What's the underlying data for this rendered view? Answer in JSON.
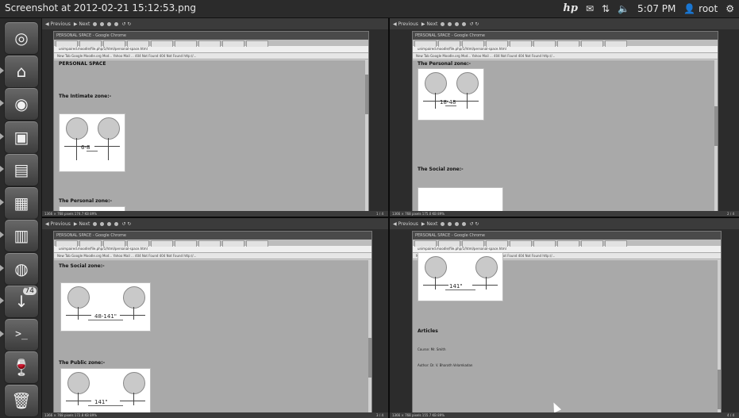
{
  "window_title": "Screenshot at 2012-02-21 15:12:53.png",
  "tray": {
    "brand": "hp",
    "mail_icon": "envelope-icon",
    "network_icon": "arrows-updown-icon",
    "volume_icon": "speaker-icon",
    "time": "5:07 PM",
    "user": "root",
    "gear_icon": "gear-icon"
  },
  "launcher": {
    "items": [
      {
        "name": "ubuntu-dash-icon",
        "glyph": "◎"
      },
      {
        "name": "home-folder-icon",
        "glyph": "⌂"
      },
      {
        "name": "chrome-icon",
        "glyph": "◉"
      },
      {
        "name": "image-viewer-icon",
        "glyph": "▣"
      },
      {
        "name": "writer-icon",
        "glyph": "▤"
      },
      {
        "name": "calc-icon",
        "glyph": "▦"
      },
      {
        "name": "impress-icon",
        "glyph": "▥"
      },
      {
        "name": "firefox-icon",
        "glyph": "◍"
      },
      {
        "name": "update-manager-icon",
        "glyph": "↓",
        "badge": "74"
      },
      {
        "name": "terminal-icon",
        "glyph": ">_"
      },
      {
        "name": "wine-icon",
        "glyph": "🍷"
      },
      {
        "name": "trash-icon",
        "glyph": "🗑"
      }
    ]
  },
  "viewer": {
    "toolbar_prev": "Previous",
    "toolbar_next": "Next"
  },
  "panes": [
    {
      "browser_title": "PERSONAL SPACE - Google Chrome",
      "url": "unimpaired.moodle/file.php/1/html/personal-space.html",
      "bookmarks": "New Tab   Google   Moodle.org Mod...   Yahoo Mail ...   404 Not Found   404 Not Found   http://...",
      "headings": [
        "PERSONAL SPACE",
        "The Intimate zone:-",
        "The Personal zone:-"
      ],
      "measure": "6-8",
      "status": "1366 × 768 pixels  174.7 KB  89%",
      "page_num": "1 / 4"
    },
    {
      "browser_title": "PERSONAL SPACE - Google Chrome",
      "url": "unimpaired.moodle/file.php/1/html/personal-space.html",
      "bookmarks": "New Tab   Google   Moodle.org Mod...   Yahoo Mail ...   404 Not Found   404 Not Found   http://...",
      "headings": [
        "The Personal zone:-",
        "The Social zone:-"
      ],
      "measure": "18-48",
      "status": "1366 × 768 pixels  175.0 KB  89%",
      "page_num": "2 / 4"
    },
    {
      "browser_title": "PERSONAL SPACE - Google Chrome",
      "url": "unimpaired.moodle/file.php/1/html/personal-space.html",
      "bookmarks": "New Tab   Google   Moodle.org Mod...   Yahoo Mail ...   404 Not Found   404 Not Found   http://...",
      "headings": [
        "The Social zone:-",
        "The Public zone:-"
      ],
      "measure": "48-141\"",
      "measure2": "141\"",
      "status": "1366 × 768 pixels  172.8 KB  89%",
      "page_num": "3 / 4"
    },
    {
      "browser_title": "PERSONAL SPACE - Google Chrome",
      "url": "unimpaired.moodle/file.php/1/html/personal-space.html",
      "bookmarks": "New Tab   Google   Moodle.org Mod...   Yahoo Mail ...   404 Not Found   404 Not Found   http://...",
      "headings": [
        "Articles"
      ],
      "measure": "141\"",
      "lines": [
        "Course: Mr. Smith",
        "Author: Dr. V. Bharath Velamkadan"
      ],
      "status": "1366 × 768 pixels  155.7 KB  89%",
      "page_num": "4 / 4"
    }
  ]
}
